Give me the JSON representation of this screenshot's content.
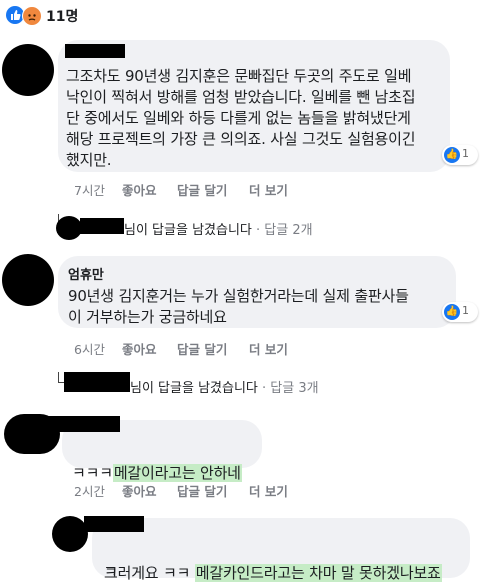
{
  "header": {
    "reaction_count": "11명",
    "reactions": [
      "like-icon",
      "angry-icon"
    ]
  },
  "comments": [
    {
      "author": "",
      "text": "그조차도 90년생 김지훈은 문빠집단 두곳의 주도로 일베\n낙인이 찍혀서 방해를 엄청 받았습니다. 일베를 뺀 남초집\n단 중에서도 일베와 하등 다를게 없는 놈들을 밝혀냈단게\n해당 프로젝트의 가장 큰 의의죠. 사실 그것도 실험용이긴\n했지만.",
      "likes": "1",
      "time": "7시간",
      "like_label": "좋아요",
      "reply_label": "답글 달기",
      "more_label": "더 보기",
      "reply_summary": "님이 답글을 남겼습니다",
      "reply_count": "· 답글 2개"
    },
    {
      "author": "엄휴만",
      "text": "90년생 김지훈거는 누가 실험한거라는데 실제 출판사들\n이 거부하는가 궁금하네요",
      "likes": "1",
      "time": "6시간",
      "like_label": "좋아요",
      "reply_label": "답글 달기",
      "more_label": "더 보기",
      "reply_summary": "님이 답글을 남겼습니다",
      "reply_count": "· 답글 3개"
    },
    {
      "author": "",
      "text_prefix": "ㅋㅋㅋ",
      "text_highlight": "메갈이라고는 안하네",
      "time": "2시간",
      "like_label": "좋아요",
      "reply_label": "답글 달기",
      "more_label": "더 보기"
    },
    {
      "author": "",
      "text_prefix": "그러게요 ㅋㅋ ",
      "text_highlight": "메갈카인드라고는 차마 말 못하겠나보죠",
      "text_suffix": "ㅋ"
    }
  ],
  "colors": {
    "bubble": "#f0f1f4",
    "like_blue": "#1877f2",
    "highlight": "#c6ecc6",
    "meta": "#7a7d84"
  }
}
